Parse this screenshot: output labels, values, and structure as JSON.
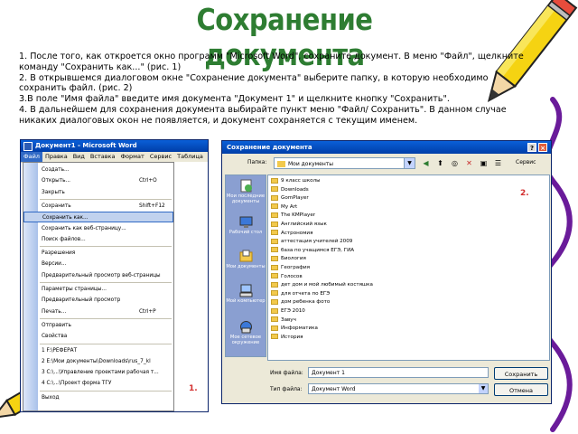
{
  "title": "Сохранение документа",
  "instructions": [
    "1. После того, как откроется окно программ \"Microsoft Word\", сохраните документ. В меню \"Файл\", щелкните команду \"Сохранить как...\" (рис. 1)",
    "2. В открывшемся диалоговом окне \"Сохранение документа\" выберите папку, в которую необходимо сохранить файл. (рис. 2)",
    "3.В поле \"Имя файла\" введите имя документа \"Документ 1\" и щелкните кнопку \"Сохранить\".",
    "4. В дальнейшем для сохранения документа выбирайте пункт меню \"Файл/ Сохранить\". В данном случае никаких диалоговых окон не появляется, и документ сохраняется с текущим именем."
  ],
  "word": {
    "window_title": "Документ1 - Microsoft Word",
    "menubar": [
      "Файл",
      "Правка",
      "Вид",
      "Вставка",
      "Формат",
      "Сервис",
      "Таблица"
    ],
    "menu_items": [
      {
        "label": "Создать...",
        "shortcut": ""
      },
      {
        "label": "Открыть...",
        "shortcut": "Ctrl+O"
      },
      {
        "label": "Закрыть",
        "shortcut": ""
      },
      {
        "label": "Сохранить",
        "shortcut": "Shift+F12"
      },
      {
        "label": "Сохранить как...",
        "shortcut": "",
        "highlighted": true
      },
      {
        "label": "Сохранить как веб-страницу...",
        "shortcut": ""
      },
      {
        "label": "Поиск файлов...",
        "shortcut": ""
      },
      {
        "label": "Разрешения",
        "shortcut": ""
      },
      {
        "label": "Версии...",
        "shortcut": ""
      },
      {
        "label": "Предварительный просмотр веб-страницы",
        "shortcut": ""
      },
      {
        "label": "Параметры страницы...",
        "shortcut": ""
      },
      {
        "label": "Предварительный просмотр",
        "shortcut": ""
      },
      {
        "label": "Печать...",
        "shortcut": "Ctrl+P"
      },
      {
        "label": "Отправить",
        "shortcut": ""
      },
      {
        "label": "Свойства",
        "shortcut": ""
      },
      {
        "label": "1 F:\\РЕФЕРАТ",
        "shortcut": ""
      },
      {
        "label": "2 E:\\Мои документы\\Downloads\\rus_7_kl",
        "shortcut": ""
      },
      {
        "label": "3 C:\\...\\Управление проектами рабочая т...",
        "shortcut": ""
      },
      {
        "label": "4 C:\\...\\Проект форма ТГУ",
        "shortcut": ""
      },
      {
        "label": "Выход",
        "shortcut": ""
      }
    ],
    "figure_label": "1."
  },
  "dialog": {
    "title": "Сохранение документа",
    "folder_label": "Папка:",
    "folder_value": "Мои документы",
    "service_label": "Сервис",
    "places": [
      "Мои последние документы",
      "Рабочий стол",
      "Мои документы",
      "Мой компьютер",
      "Мое сетевое окружение"
    ],
    "files": [
      "9 класс школы",
      "Downloads",
      "GomPlayer",
      "My Art",
      "The KMPlayer",
      "Английский язык",
      "Астрономия",
      "аттестация учителей 2009",
      "база по учащимся ЕГЭ, ГИА",
      "Биология",
      "География",
      "Голосов",
      "дет дом и мой любимый костяшка",
      "для отчета по ЕГЭ",
      "дом ребенка фото",
      "ЕГЭ 2010",
      "Завуч",
      "Информатика",
      "История"
    ],
    "figure_label": "2.",
    "filename_label": "Имя файла:",
    "filename_value": "Документ 1",
    "filetype_label": "Тип файла:",
    "filetype_value": "Документ Word",
    "save_button": "Сохранить",
    "cancel_button": "Отмена"
  },
  "colors": {
    "title": "#2e7d32",
    "figure_label": "#d32f2f",
    "titlebar": "#0a5fd8"
  }
}
